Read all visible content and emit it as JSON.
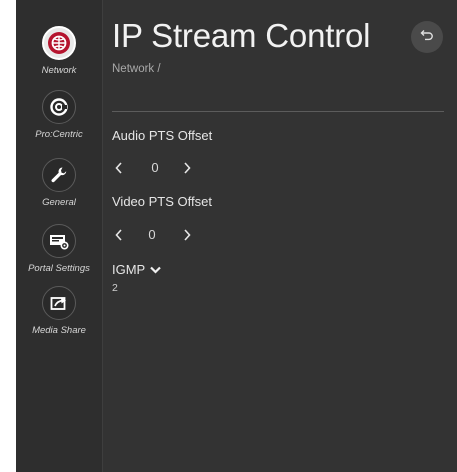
{
  "sidebar": {
    "items": [
      {
        "label": "Network",
        "icon": "network-icon",
        "active": true
      },
      {
        "label": "Pro:Centric",
        "icon": "procentric-icon",
        "active": false
      },
      {
        "label": "General",
        "icon": "wrench-icon",
        "active": false
      },
      {
        "label": "Portal Settings",
        "icon": "portal-settings-icon",
        "active": false
      },
      {
        "label": "Media Share",
        "icon": "media-share-icon",
        "active": false
      }
    ]
  },
  "header": {
    "title": "IP Stream Control",
    "breadcrumb": "Network /",
    "back_icon": "back-arrow-icon"
  },
  "settings": {
    "audio_pts": {
      "label": "Audio PTS Offset",
      "value": "0"
    },
    "video_pts": {
      "label": "Video PTS Offset",
      "value": "0"
    },
    "igmp": {
      "label": "IGMP",
      "value": "2",
      "icon": "chevron-down-icon"
    }
  },
  "colors": {
    "background": "#333333",
    "sidebar": "#2e2e2e",
    "accent_red": "#b5142e",
    "text": "#e6e6e6"
  }
}
